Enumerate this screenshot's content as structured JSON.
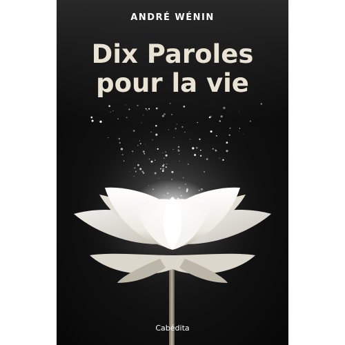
{
  "cover": {
    "author": "ANDRÉ WÉNIN",
    "title_line1": "Dix Paroles",
    "title_line2": "pour la vie",
    "publisher": "Cabédita"
  },
  "colors": {
    "background": "#000000",
    "title": "#e9e3d3",
    "author": "#ffffff",
    "petal": "#f4f2ec",
    "glow": "#ffffff"
  },
  "icons": [
    "lotus-flower-illustration",
    "sparkle-particles"
  ]
}
